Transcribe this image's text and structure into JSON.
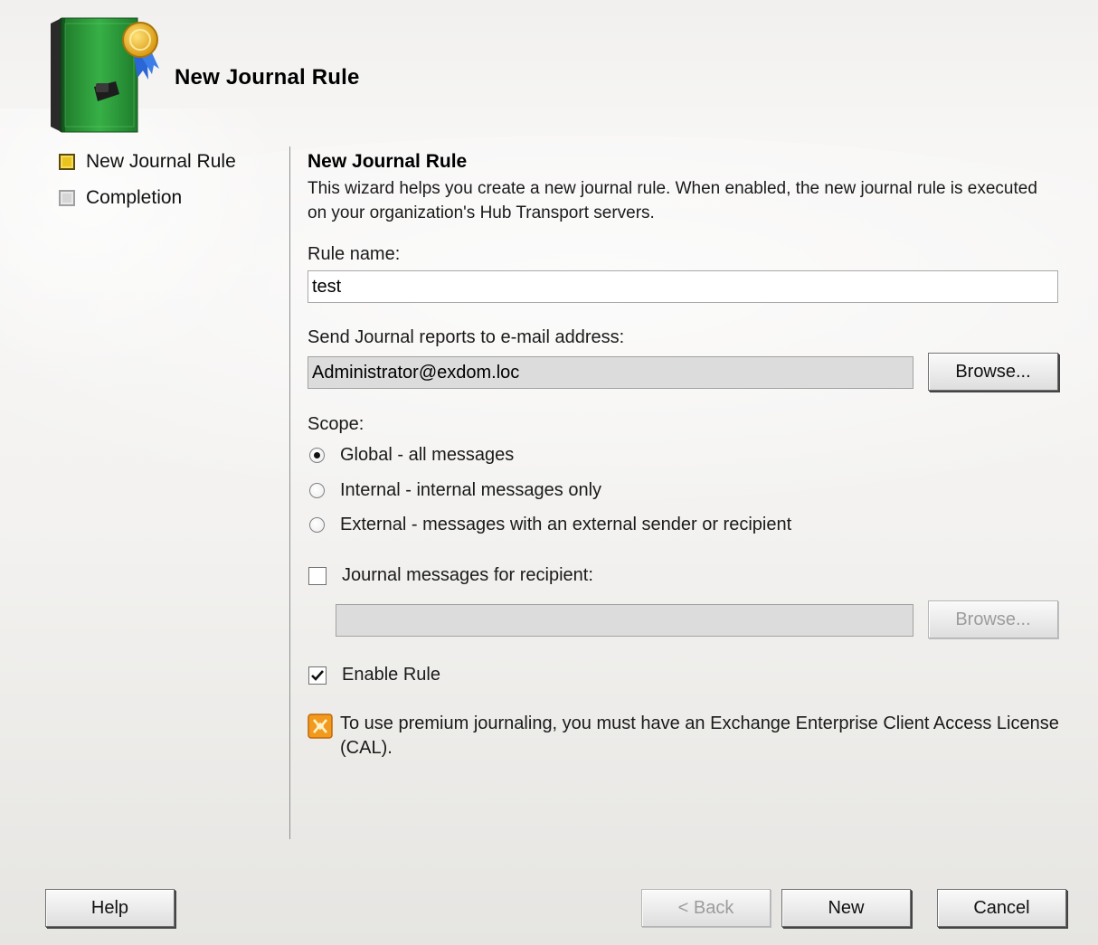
{
  "window": {
    "header_title": "New Journal Rule"
  },
  "steps": [
    {
      "label": "New Journal Rule",
      "state": "active"
    },
    {
      "label": "Completion",
      "state": "pending"
    }
  ],
  "content": {
    "section_title": "New Journal Rule",
    "description": "This wizard helps you create a new journal rule. When enabled, the new journal rule is executed on your organization's Hub Transport servers.",
    "rule_name_label": "Rule name:",
    "rule_name_value": "test",
    "send_reports_label": "Send Journal reports to e-mail address:",
    "send_reports_value": "Administrator@exdom.loc",
    "browse_label": "Browse...",
    "scope_label": "Scope:",
    "scope_options": [
      {
        "label": "Global - all messages",
        "checked": true
      },
      {
        "label": "Internal - internal messages only",
        "checked": false
      },
      {
        "label": "External - messages with an external sender or recipient",
        "checked": false
      }
    ],
    "journal_recipient_label": "Journal messages for recipient:",
    "journal_recipient_checked": false,
    "journal_recipient_value": "",
    "browse_disabled_label": "Browse...",
    "enable_rule_label": "Enable Rule",
    "enable_rule_checked": true,
    "info_text": "To use premium journaling, you must have an Exchange Enterprise Client Access License (CAL)."
  },
  "footer": {
    "help_label": "Help",
    "back_label": "< Back",
    "new_label": "New",
    "cancel_label": "Cancel"
  },
  "colors": {
    "book_green": "#2e9a3a",
    "step_active": "#e9c41f",
    "info_orange": "#f29a1d"
  },
  "icons": {
    "header": "journal-book-icon",
    "info": "exchange-info-icon"
  }
}
